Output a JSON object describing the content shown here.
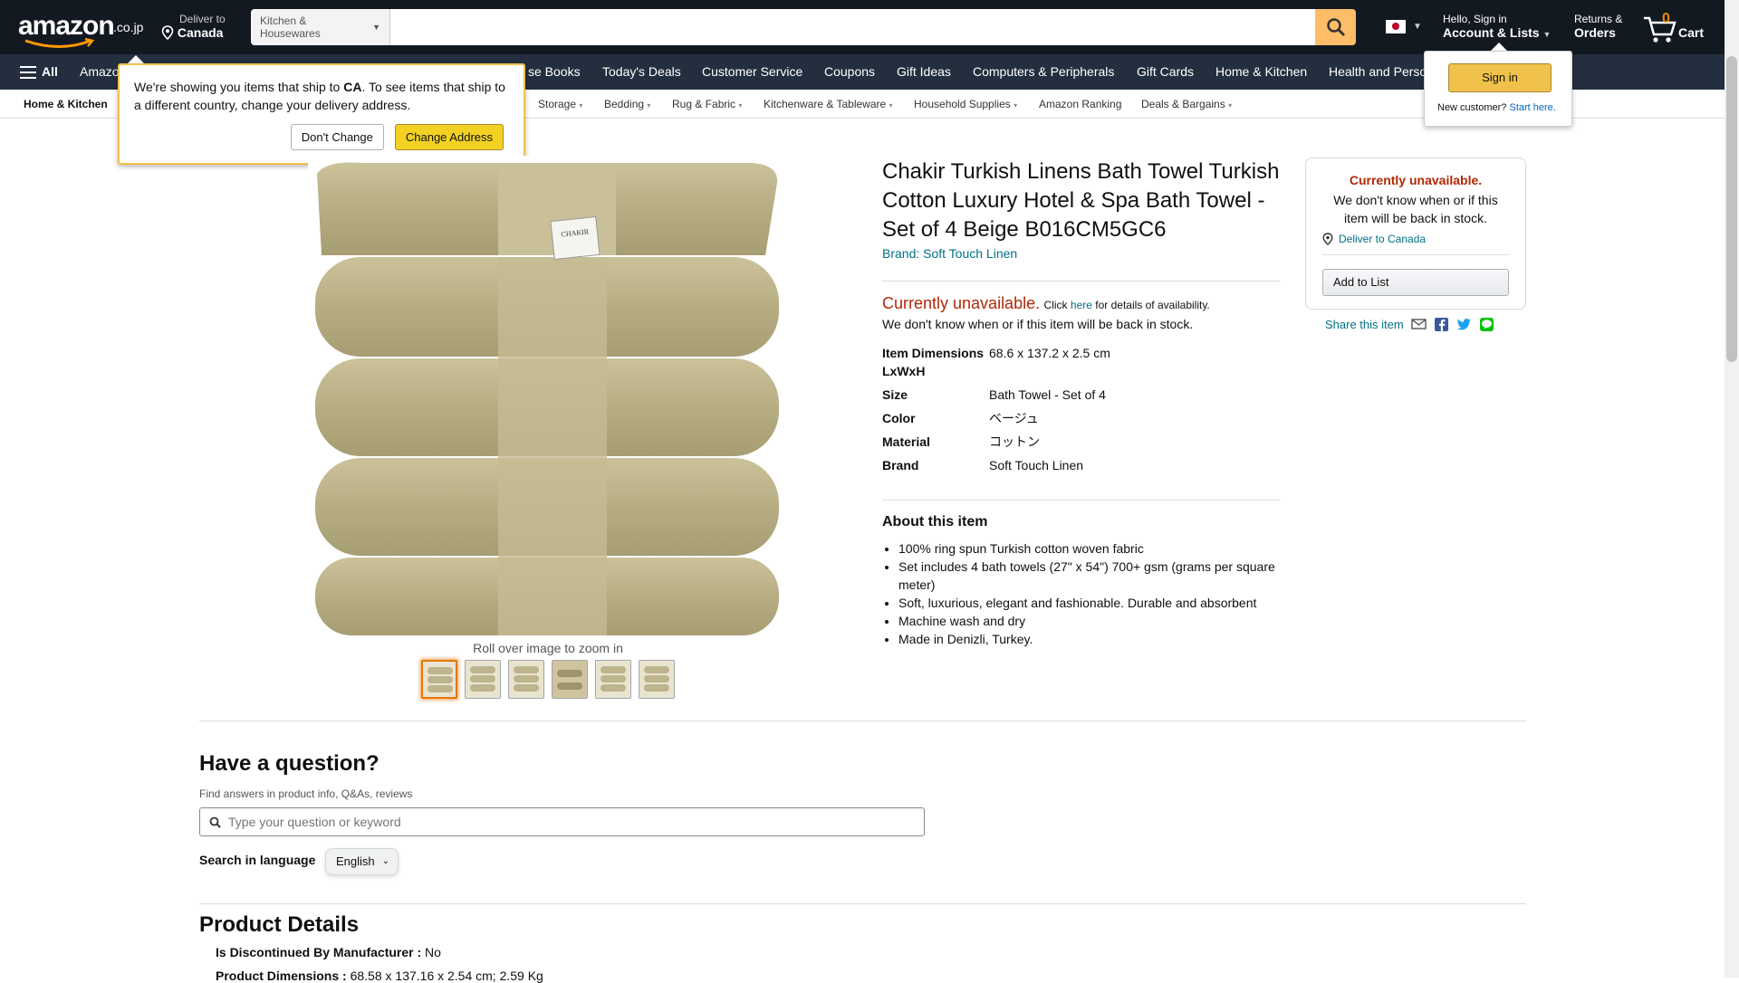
{
  "header": {
    "logo": "amazon",
    "logo_tld": ".co.jp",
    "deliver_line1": "Deliver to",
    "deliver_line2": "Canada",
    "search_category": "Kitchen & Housewares",
    "search_placeholder": "",
    "account_line1": "Hello, Sign in",
    "account_line2": "Account & Lists",
    "returns_line1": "Returns &",
    "returns_line2": "Orders",
    "cart_count": "0",
    "cart_label": "Cart"
  },
  "main_nav": {
    "all_label": "All",
    "items": [
      "Amazon",
      "se Books",
      "Today's Deals",
      "Customer Service",
      "Coupons",
      "Gift Ideas",
      "Computers & Peripherals",
      "Gift Cards",
      "Home & Kitchen",
      "Health and Perso"
    ]
  },
  "sub_nav": {
    "home": "Home & Kitchen",
    "items": [
      "Storage",
      "Bedding",
      "Rug & Fabric",
      "Kitchenware & Tableware",
      "Household Supplies",
      "Amazon Ranking",
      "Deals & Bargains"
    ]
  },
  "popover": {
    "msg_part1": "We're showing you items that ship to ",
    "msg_country": "CA",
    "msg_part2": ". To see items that ship to a different country, change your delivery address.",
    "dont_change": "Don't Change",
    "change_address": "Change Address"
  },
  "signin_flyout": {
    "button": "Sign in",
    "new_customer": "New customer?",
    "start_here": "Start here."
  },
  "product": {
    "title": "Chakir Turkish Linens Bath Towel Turkish Cotton Luxury Hotel & Spa Bath Towel - Set of 4 Beige B016CM5GC6",
    "brand": "Brand: Soft Touch Linen",
    "image_label": "CHAKIR",
    "zoom_hint": "Roll over image to zoom in",
    "unavailable_big": "Currently unavailable.",
    "unavailable_click": "Click",
    "unavailable_here": "here",
    "unavailable_details": "for details of availability.",
    "unavailable_line2": "We don't know when or if this item will be back in stock.",
    "specs": [
      {
        "key": "Item Dimensions LxWxH",
        "value": "68.6 x 137.2 x 2.5 cm"
      },
      {
        "key": "Size",
        "value": "Bath Towel - Set of 4"
      },
      {
        "key": "Color",
        "value": "ベージュ"
      },
      {
        "key": "Material",
        "value": "コットン"
      },
      {
        "key": "Brand",
        "value": "Soft Touch Linen"
      }
    ],
    "about_heading": "About this item",
    "about": [
      "100% ring spun Turkish cotton woven fabric",
      "Set includes 4 bath towels (27\" x 54\") 700+ gsm (grams per square meter)",
      "Soft, luxurious, elegant and fashionable. Durable and absorbent",
      "Machine wash and dry",
      "Made in Denizli, Turkey."
    ]
  },
  "buybox": {
    "title": "Currently unavailable.",
    "text": "We don't know when or if this item will be back in stock.",
    "deliver": "Deliver to Canada",
    "add_to_list": "Add to List",
    "share": "Share this item"
  },
  "question": {
    "heading": "Have a question?",
    "sub": "Find answers in product info, Q&As, reviews",
    "placeholder": "Type your question or keyword",
    "lang_label": "Search in language",
    "lang_value": "English"
  },
  "product_details": {
    "heading": "Product Details",
    "rows": [
      {
        "key": "Is Discontinued By Manufacturer",
        "value": "No"
      },
      {
        "key": "Product Dimensions",
        "value": "68.58 x 137.16 x 2.54 cm; 2.59 Kg"
      }
    ]
  }
}
